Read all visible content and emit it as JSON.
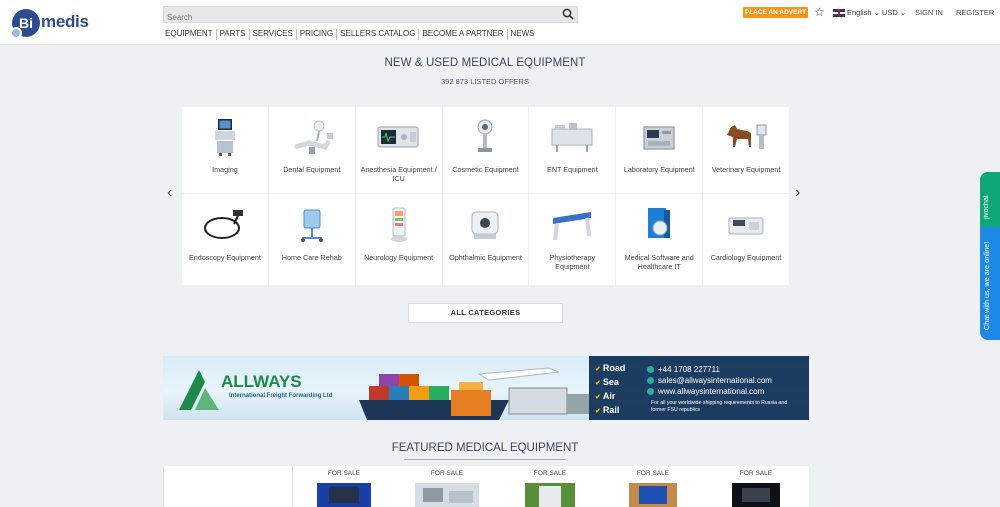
{
  "header": {
    "logo_bi": "Bi",
    "logo_text": "medis",
    "search_placeholder": "Search",
    "nav": [
      "EQUIPMENT",
      "PARTS",
      "SERVICES",
      "PRICING",
      "SELLERS CATALOG",
      "BECOME A PARTNER",
      "NEWS"
    ],
    "place_advert": "PLACE AN ADVERT",
    "language": "English",
    "currency": "USD",
    "sign_in": "SIGN IN",
    "register": "REGISTER"
  },
  "hero": {
    "title": "NEW & USED MEDICAL EQUIPMENT",
    "offers": "392 873 LISTED OFFERS"
  },
  "categories": [
    {
      "label": "Imaging"
    },
    {
      "label": "Dental Equipment"
    },
    {
      "label": "Anesthesia Equipment / ICU"
    },
    {
      "label": "Cosmetic Equipment"
    },
    {
      "label": "ENT Equipment"
    },
    {
      "label": "Laboratory Equipment"
    },
    {
      "label": "Veterinary Equipment"
    },
    {
      "label": "Endoscopy Equipment"
    },
    {
      "label": "Home Care Rehab"
    },
    {
      "label": "Neurology Equipment"
    },
    {
      "label": "Ophthalmic Equipment"
    },
    {
      "label": "Physiotherapy Equipment"
    },
    {
      "label": "Medical Software and Healthcare IT"
    },
    {
      "label": "Cardiology Equipment"
    }
  ],
  "all_categories": "ALL CATEGORIES",
  "banner": {
    "brand": "ALLWAYS",
    "tagline": "International Freight Forwarding Ltd",
    "modes": [
      "Road",
      "Sea",
      "Air",
      "Rail"
    ],
    "phone": "+44 1708 227711",
    "email": "sales@allwaysinternational.com",
    "website": "www.allwaysinternational.com",
    "note": "For all your worldwide shipping requirements to Russia and former FSU republics"
  },
  "featured": {
    "title": "FEATURED MEDICAL EQUIPMENT",
    "items": [
      "FOR SALE",
      "FOR SALE",
      "FOR SALE",
      "FOR SALE",
      "FOR SALE"
    ]
  },
  "chat": {
    "brand": "jivochat",
    "text": "Chat with us, we are online!"
  },
  "colors": {
    "brand_blue": "#2f4c8f",
    "accent_orange": "#f7941d",
    "chat_blue": "#1e88e5",
    "chat_green": "#0fa77a"
  }
}
